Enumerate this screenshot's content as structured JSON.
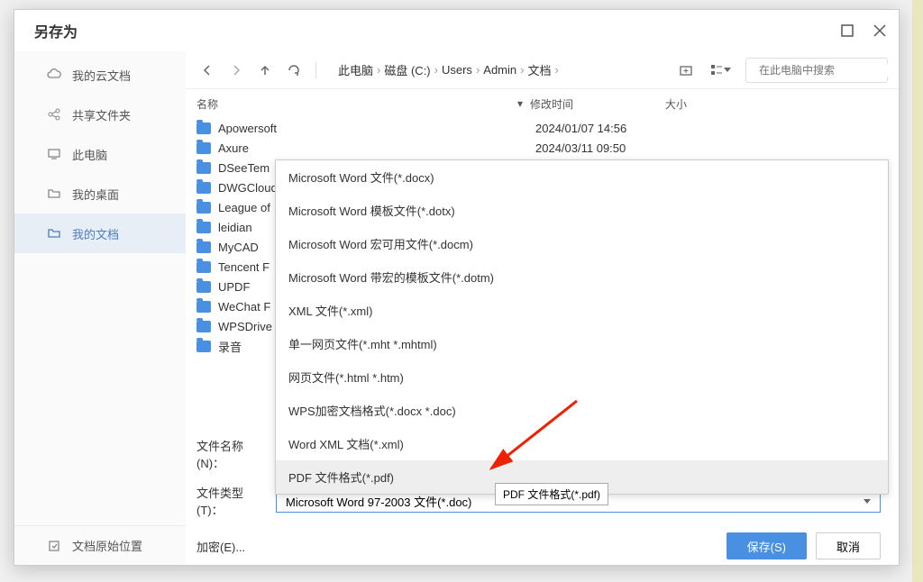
{
  "title": "另存为",
  "sidebar": {
    "items": [
      {
        "icon": "cloud",
        "label": "我的云文档"
      },
      {
        "icon": "share",
        "label": "共享文件夹"
      },
      {
        "icon": "pc",
        "label": "此电脑"
      },
      {
        "icon": "desktop",
        "label": "我的桌面"
      },
      {
        "icon": "folder",
        "label": "我的文档"
      }
    ],
    "footer": {
      "icon": "restore",
      "label": "文档原始位置"
    }
  },
  "breadcrumb": [
    "此电脑",
    "磁盘 (C:)",
    "Users",
    "Admin",
    "文档"
  ],
  "search": {
    "placeholder": "在此电脑中搜索"
  },
  "columns": {
    "name": "名称",
    "date": "修改时间",
    "size": "大小"
  },
  "files": [
    {
      "name": "Apowersoft",
      "date": "2024/01/07 14:56"
    },
    {
      "name": "Axure",
      "date": "2024/03/11 09:50"
    },
    {
      "name": "DSeeTem",
      "date": ""
    },
    {
      "name": "DWGCloud",
      "date": ""
    },
    {
      "name": "League of",
      "date": ""
    },
    {
      "name": "leidian",
      "date": ""
    },
    {
      "name": "MyCAD",
      "date": ""
    },
    {
      "name": "Tencent F",
      "date": ""
    },
    {
      "name": "UPDF",
      "date": ""
    },
    {
      "name": "WeChat F",
      "date": ""
    },
    {
      "name": "WPSDrive",
      "date": ""
    },
    {
      "name": "录音",
      "date": ""
    }
  ],
  "dropdown": {
    "items": [
      "Microsoft Word 文件(*.docx)",
      "Microsoft Word 模板文件(*.dotx)",
      "Microsoft Word 宏可用文件(*.docm)",
      "Microsoft Word 带宏的模板文件(*.dotm)",
      "XML 文件(*.xml)",
      "单一网页文件(*.mht *.mhtml)",
      "网页文件(*.html *.htm)",
      "WPS加密文档格式(*.docx *.doc)",
      "Word XML 文档(*.xml)",
      "PDF 文件格式(*.pdf)"
    ]
  },
  "tooltip": "PDF 文件格式(*.pdf)",
  "form": {
    "filename_label": "文件名称(N)：",
    "filetype_label": "文件类型(T)：",
    "filetype_value": "Microsoft Word 97-2003 文件(*.doc)",
    "encrypt": "加密(E)..."
  },
  "buttons": {
    "save": "保存(S)",
    "cancel": "取消"
  }
}
